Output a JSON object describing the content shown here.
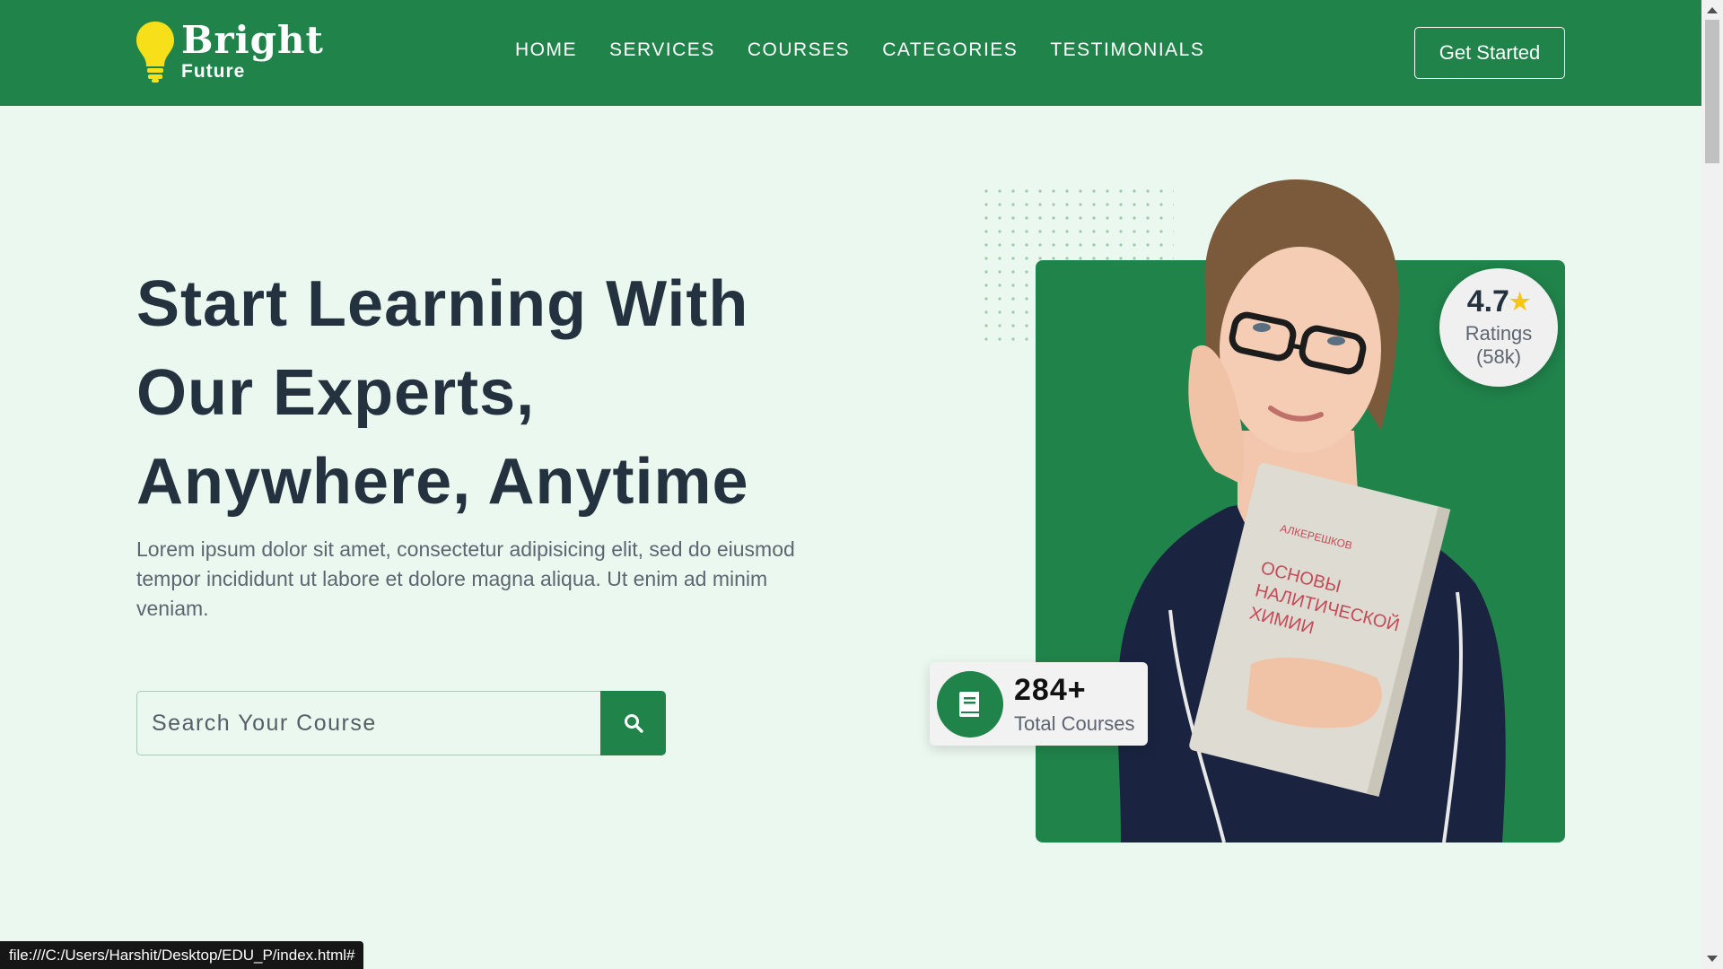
{
  "brand": {
    "name": "Bright",
    "tagline": "Future",
    "bulb_color": "#f7e01a"
  },
  "nav": {
    "items": [
      {
        "label": "HOME"
      },
      {
        "label": "SERVICES"
      },
      {
        "label": "COURSES"
      },
      {
        "label": "CATEGORIES"
      },
      {
        "label": "TESTIMONIALS"
      }
    ],
    "cta_label": "Get Started"
  },
  "hero": {
    "title_lines": [
      "Start Learning With",
      "Our Experts,",
      "Anywhere, Anytime"
    ],
    "description": "Lorem ipsum dolor sit amet, consectetur adipisicing elit, sed do eiusmod tempor incididunt ut labore et dolore magna aliqua. Ut enim ad minim veniam."
  },
  "search": {
    "placeholder": "Search Your Course",
    "value": "",
    "icon": "search-icon"
  },
  "rating": {
    "value": "4.7",
    "label": "Ratings",
    "count": "(58k)",
    "icon": "star-icon"
  },
  "courses": {
    "count": "284+",
    "label": "Total Courses",
    "icon": "book-icon"
  },
  "status_bar": {
    "url": "file:///C:/Users/Harshit/Desktop/EDU_P/index.html#"
  },
  "colors": {
    "primary": "#20834a",
    "background": "#ebf8ef",
    "heading": "#243240",
    "body_text": "#5d6670",
    "star": "#f5c518"
  }
}
